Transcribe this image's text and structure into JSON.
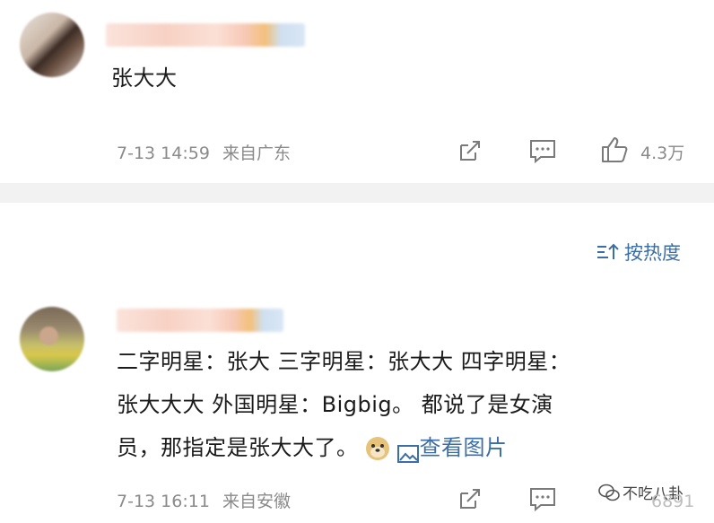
{
  "comment1": {
    "text": "张大大",
    "time": "7-13 14:59",
    "location": "来自广东",
    "likes": "4.3万"
  },
  "sort": {
    "label": "按热度"
  },
  "comment2": {
    "text_line1": "二字明星：张大  三字明星：张大大  四字明星：",
    "text_line2": "张大大大  外国明星：Bigbig。 都说了是女演",
    "text_line3": "员，那指定是张大大了。",
    "image_link": "查看图片",
    "time": "7-13 16:11",
    "location": "来自安徽",
    "likes": "6891"
  },
  "watermark": {
    "text": "不吃八卦"
  },
  "icons": [
    "share-icon",
    "comment-icon",
    "like-icon",
    "sort-icon",
    "emoji-doge-icon",
    "image-icon",
    "wechat-watermark-icon"
  ]
}
